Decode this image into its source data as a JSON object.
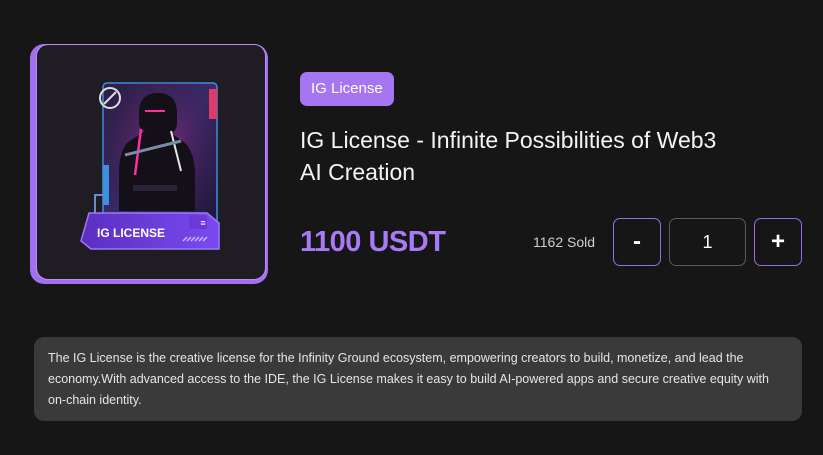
{
  "product": {
    "image_label": "IG LICENSE",
    "badge": "IG License",
    "title": "IG License - Infinite Possibilities of Web3 AI Creation",
    "price": "1100 USDT",
    "sold": "1162 Sold",
    "quantity": "1",
    "decrement_label": "-",
    "increment_label": "+",
    "description": "The IG License is the creative license for the Infinity Ground ecosystem, empowering creators to build, monetize, and lead the economy.With advanced access to the IDE, the IG License makes it easy to build AI-powered apps and secure creative equity with on-chain identity."
  },
  "colors": {
    "accent": "#a575f2",
    "background": "#161616",
    "description_bg": "#3a3a3a"
  }
}
